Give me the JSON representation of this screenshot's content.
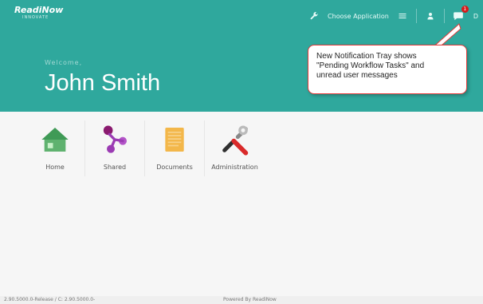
{
  "header": {
    "logo_text": "ReadiNow",
    "logo_subtext": "INNOVATE",
    "choose_application_label": "Choose Application",
    "notification_count": "1",
    "truncated_right_label": "D",
    "accent": "#2fa89d"
  },
  "hero": {
    "welcome_label": "Welcome,",
    "username": "John Smith"
  },
  "callout": {
    "lines": [
      "New Notification Tray shows",
      "\"Pending Workflow Tasks\" and",
      "unread user messages"
    ],
    "border_color": "#e23c3c"
  },
  "apps": [
    {
      "label": "Home",
      "icon": "home-icon"
    },
    {
      "label": "Shared",
      "icon": "shared-icon"
    },
    {
      "label": "Documents",
      "icon": "documents-icon"
    },
    {
      "label": "Administration",
      "icon": "administration-icon"
    }
  ],
  "footer": {
    "version_text": "2.90.5000.0-Release / C: 2.90.5000.0-",
    "powered_text": "Powered By ReadiNow"
  }
}
